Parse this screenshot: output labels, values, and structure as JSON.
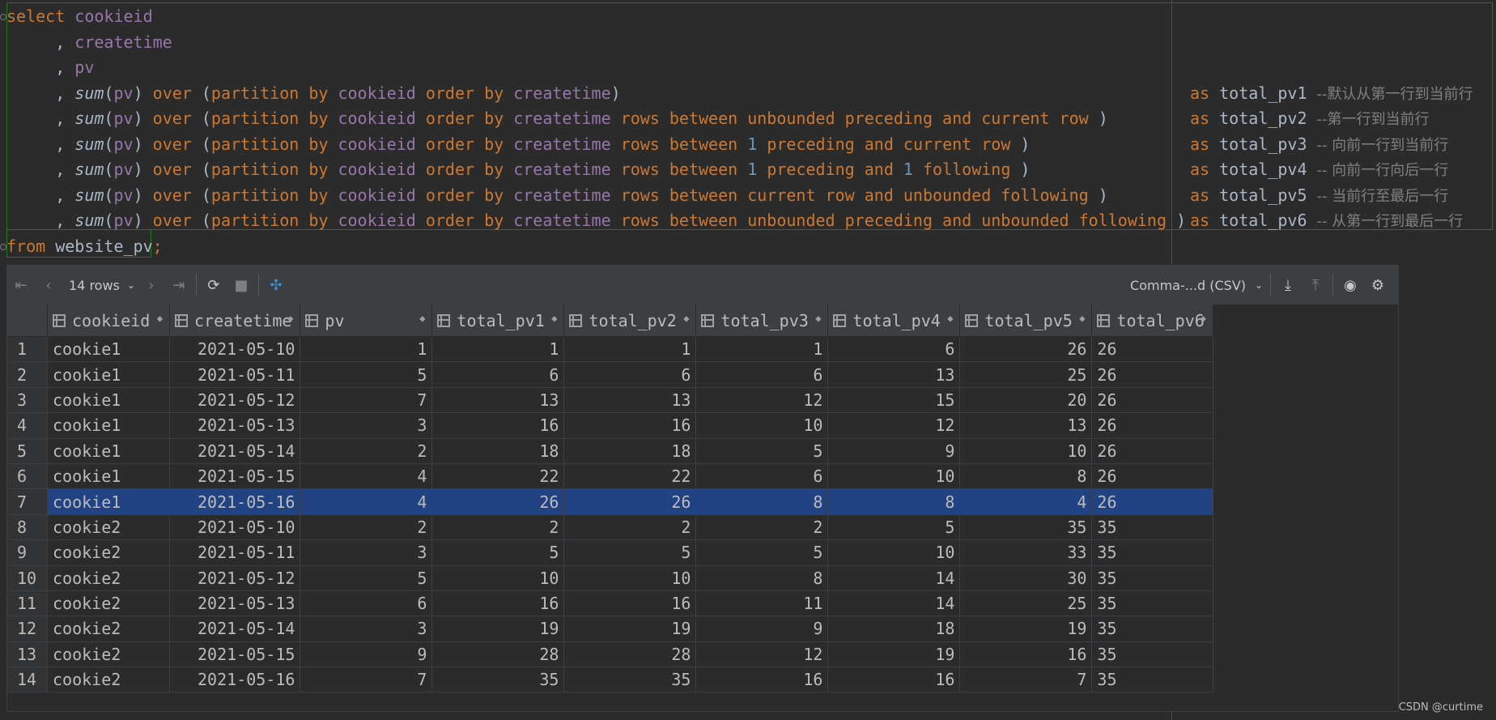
{
  "editor": {
    "lines": [
      {
        "main": [
          [
            "kw",
            "select"
          ],
          [
            "txt",
            " "
          ],
          [
            "col",
            "cookieid"
          ]
        ],
        "tail": []
      },
      {
        "main": [
          [
            "txt",
            "     , "
          ],
          [
            "col",
            "createtime"
          ]
        ],
        "tail": []
      },
      {
        "main": [
          [
            "txt",
            "     , "
          ],
          [
            "col",
            "pv"
          ]
        ],
        "tail": []
      },
      {
        "main": [
          [
            "txt",
            "     , "
          ],
          [
            "fn",
            "sum"
          ],
          [
            "txt",
            "("
          ],
          [
            "col",
            "pv"
          ],
          [
            "txt",
            ") "
          ],
          [
            "kw",
            "over"
          ],
          [
            "txt",
            " ("
          ],
          [
            "kw",
            "partition by"
          ],
          [
            "txt",
            " "
          ],
          [
            "col",
            "cookieid"
          ],
          [
            "txt",
            " "
          ],
          [
            "kw",
            "order by"
          ],
          [
            "txt",
            " "
          ],
          [
            "col",
            "createtime"
          ],
          [
            "txt",
            ")"
          ]
        ],
        "tail": [
          [
            "kw",
            "as"
          ],
          [
            "txt",
            " total_pv1 "
          ],
          [
            "cmt",
            "--默认从第一行到当前行"
          ]
        ]
      },
      {
        "main": [
          [
            "txt",
            "     , "
          ],
          [
            "fn",
            "sum"
          ],
          [
            "txt",
            "("
          ],
          [
            "col",
            "pv"
          ],
          [
            "txt",
            ") "
          ],
          [
            "kw",
            "over"
          ],
          [
            "txt",
            " ("
          ],
          [
            "kw",
            "partition by"
          ],
          [
            "txt",
            " "
          ],
          [
            "col",
            "cookieid"
          ],
          [
            "txt",
            " "
          ],
          [
            "kw",
            "order by"
          ],
          [
            "txt",
            " "
          ],
          [
            "col",
            "createtime"
          ],
          [
            "txt",
            " "
          ],
          [
            "kw",
            "rows between unbounded preceding and current row"
          ],
          [
            "txt",
            " )"
          ]
        ],
        "tail": [
          [
            "kw",
            "as"
          ],
          [
            "txt",
            " total_pv2 "
          ],
          [
            "cmt",
            "--第一行到当前行"
          ]
        ]
      },
      {
        "main": [
          [
            "txt",
            "     , "
          ],
          [
            "fn",
            "sum"
          ],
          [
            "txt",
            "("
          ],
          [
            "col",
            "pv"
          ],
          [
            "txt",
            ") "
          ],
          [
            "kw",
            "over"
          ],
          [
            "txt",
            " ("
          ],
          [
            "kw",
            "partition by"
          ],
          [
            "txt",
            " "
          ],
          [
            "col",
            "cookieid"
          ],
          [
            "txt",
            " "
          ],
          [
            "kw",
            "order by"
          ],
          [
            "txt",
            " "
          ],
          [
            "col",
            "createtime"
          ],
          [
            "txt",
            " "
          ],
          [
            "kw",
            "rows between"
          ],
          [
            "txt",
            " "
          ],
          [
            "num",
            "1"
          ],
          [
            "txt",
            " "
          ],
          [
            "kw",
            "preceding and current row"
          ],
          [
            "txt",
            " )"
          ]
        ],
        "tail": [
          [
            "kw",
            "as"
          ],
          [
            "txt",
            " total_pv3 "
          ],
          [
            "cmt",
            "-- 向前一行到当前行"
          ]
        ]
      },
      {
        "main": [
          [
            "txt",
            "     , "
          ],
          [
            "fn",
            "sum"
          ],
          [
            "txt",
            "("
          ],
          [
            "col",
            "pv"
          ],
          [
            "txt",
            ") "
          ],
          [
            "kw",
            "over"
          ],
          [
            "txt",
            " ("
          ],
          [
            "kw",
            "partition by"
          ],
          [
            "txt",
            " "
          ],
          [
            "col",
            "cookieid"
          ],
          [
            "txt",
            " "
          ],
          [
            "kw",
            "order by"
          ],
          [
            "txt",
            " "
          ],
          [
            "col",
            "createtime"
          ],
          [
            "txt",
            " "
          ],
          [
            "kw",
            "rows between"
          ],
          [
            "txt",
            " "
          ],
          [
            "num",
            "1"
          ],
          [
            "txt",
            " "
          ],
          [
            "kw",
            "preceding and"
          ],
          [
            "txt",
            " "
          ],
          [
            "num",
            "1"
          ],
          [
            "txt",
            " "
          ],
          [
            "kw",
            "following"
          ],
          [
            "txt",
            " )"
          ]
        ],
        "tail": [
          [
            "kw",
            "as"
          ],
          [
            "txt",
            " total_pv4 "
          ],
          [
            "cmt",
            "-- 向前一行向后一行"
          ]
        ]
      },
      {
        "main": [
          [
            "txt",
            "     , "
          ],
          [
            "fn",
            "sum"
          ],
          [
            "txt",
            "("
          ],
          [
            "col",
            "pv"
          ],
          [
            "txt",
            ") "
          ],
          [
            "kw",
            "over"
          ],
          [
            "txt",
            " ("
          ],
          [
            "kw",
            "partition by"
          ],
          [
            "txt",
            " "
          ],
          [
            "col",
            "cookieid"
          ],
          [
            "txt",
            " "
          ],
          [
            "kw",
            "order by"
          ],
          [
            "txt",
            " "
          ],
          [
            "col",
            "createtime"
          ],
          [
            "txt",
            " "
          ],
          [
            "kw",
            "rows between current row and unbounded following"
          ],
          [
            "txt",
            " )"
          ]
        ],
        "tail": [
          [
            "kw",
            "as"
          ],
          [
            "txt",
            " total_pv5 "
          ],
          [
            "cmt",
            "-- 当前行至最后一行"
          ]
        ]
      },
      {
        "main": [
          [
            "txt",
            "     , "
          ],
          [
            "fn",
            "sum"
          ],
          [
            "txt",
            "("
          ],
          [
            "col",
            "pv"
          ],
          [
            "txt",
            ") "
          ],
          [
            "kw",
            "over"
          ],
          [
            "txt",
            " ("
          ],
          [
            "kw",
            "partition by"
          ],
          [
            "txt",
            " "
          ],
          [
            "col",
            "cookieid"
          ],
          [
            "txt",
            " "
          ],
          [
            "kw",
            "order by"
          ],
          [
            "txt",
            " "
          ],
          [
            "col",
            "createtime"
          ],
          [
            "txt",
            " "
          ],
          [
            "kw",
            "rows between unbounded preceding and unbounded following"
          ],
          [
            "txt",
            " )"
          ]
        ],
        "tail": [
          [
            "kw",
            "as"
          ],
          [
            "txt",
            " total_pv6 "
          ],
          [
            "cmt",
            "-- 从第一行到最后一行"
          ]
        ]
      },
      {
        "main": [
          [
            "kw",
            "from"
          ],
          [
            "txt",
            " website_pv"
          ],
          [
            "kw",
            ";"
          ]
        ],
        "tail": []
      }
    ]
  },
  "toolbar": {
    "rows_label": "14 rows",
    "format_label": "Comma-...d (CSV)"
  },
  "table": {
    "columns": [
      "cookieid",
      "createtime",
      "pv",
      "total_pv1",
      "total_pv2",
      "total_pv3",
      "total_pv4",
      "total_pv5",
      "total_pv6"
    ],
    "selected_row": 7,
    "rows": [
      [
        "cookie1",
        "2021-05-10",
        "1",
        "1",
        "1",
        "1",
        "6",
        "26",
        "26"
      ],
      [
        "cookie1",
        "2021-05-11",
        "5",
        "6",
        "6",
        "6",
        "13",
        "25",
        "26"
      ],
      [
        "cookie1",
        "2021-05-12",
        "7",
        "13",
        "13",
        "12",
        "15",
        "20",
        "26"
      ],
      [
        "cookie1",
        "2021-05-13",
        "3",
        "16",
        "16",
        "10",
        "12",
        "13",
        "26"
      ],
      [
        "cookie1",
        "2021-05-14",
        "2",
        "18",
        "18",
        "5",
        "9",
        "10",
        "26"
      ],
      [
        "cookie1",
        "2021-05-15",
        "4",
        "22",
        "22",
        "6",
        "10",
        "8",
        "26"
      ],
      [
        "cookie1",
        "2021-05-16",
        "4",
        "26",
        "26",
        "8",
        "8",
        "4",
        "26"
      ],
      [
        "cookie2",
        "2021-05-10",
        "2",
        "2",
        "2",
        "2",
        "5",
        "35",
        "35"
      ],
      [
        "cookie2",
        "2021-05-11",
        "3",
        "5",
        "5",
        "5",
        "10",
        "33",
        "35"
      ],
      [
        "cookie2",
        "2021-05-12",
        "5",
        "10",
        "10",
        "8",
        "14",
        "30",
        "35"
      ],
      [
        "cookie2",
        "2021-05-13",
        "6",
        "16",
        "16",
        "11",
        "14",
        "25",
        "35"
      ],
      [
        "cookie2",
        "2021-05-14",
        "3",
        "19",
        "19",
        "9",
        "18",
        "19",
        "35"
      ],
      [
        "cookie2",
        "2021-05-15",
        "9",
        "28",
        "28",
        "12",
        "19",
        "16",
        "35"
      ],
      [
        "cookie2",
        "2021-05-16",
        "7",
        "35",
        "35",
        "16",
        "16",
        "7",
        "35"
      ]
    ]
  },
  "watermark": "CSDN @curtime"
}
